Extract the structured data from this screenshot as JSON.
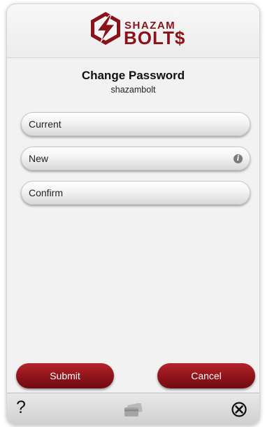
{
  "header": {
    "logo_top": "SHAZAM",
    "logo_bottom": "BOLT$",
    "logo_mark": "™"
  },
  "main": {
    "title": "Change Password",
    "username": "shazambolt",
    "fields": [
      {
        "placeholder": "Current",
        "value": ""
      },
      {
        "placeholder": "New",
        "value": "",
        "icon": "info-icon"
      },
      {
        "placeholder": "Confirm",
        "value": ""
      }
    ]
  },
  "actions": {
    "submit_label": "Submit",
    "cancel_label": "Cancel"
  },
  "toolbar": {
    "help_label": "?",
    "icons": [
      "help-icon",
      "card-icon",
      "close-circle-icon"
    ]
  },
  "colors": {
    "accent": "#8a1218",
    "background": "#f2f2f2",
    "toolbar": "#d9d9d9"
  }
}
